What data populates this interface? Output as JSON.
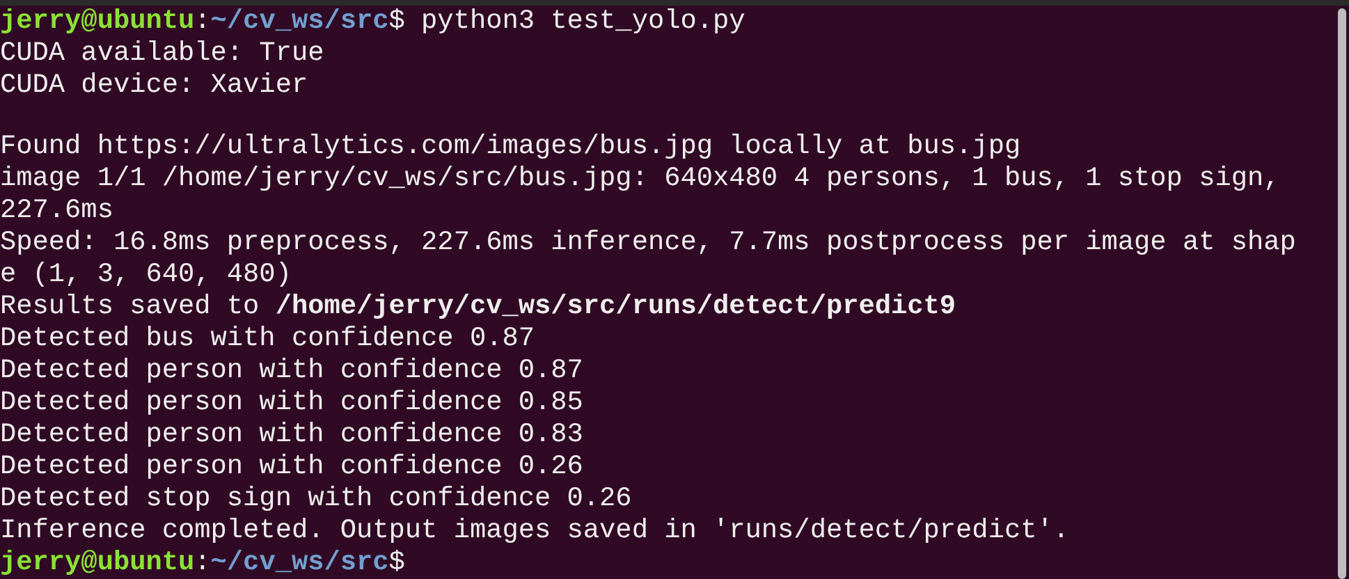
{
  "terminal": {
    "lines": [
      {
        "kind": "prompt",
        "user": "jerry@ubuntu",
        "separator": ":",
        "path": "~/cv_ws/src",
        "symbol": "$",
        "command": "python3 test_yolo.py"
      },
      {
        "kind": "output",
        "text": "CUDA available: True"
      },
      {
        "kind": "output",
        "text": "CUDA device: Xavier"
      },
      {
        "kind": "blank"
      },
      {
        "kind": "output",
        "text": "Found https://ultralytics.com/images/bus.jpg locally at bus.jpg"
      },
      {
        "kind": "output",
        "text": "image 1/1 /home/jerry/cv_ws/src/bus.jpg: 640x480 4 persons, 1 bus, 1 stop sign,"
      },
      {
        "kind": "output",
        "text": "227.6ms"
      },
      {
        "kind": "output",
        "text": "Speed: 16.8ms preprocess, 227.6ms inference, 7.7ms postprocess per image at shap"
      },
      {
        "kind": "output",
        "text": "e (1, 3, 640, 480)"
      },
      {
        "kind": "output",
        "text": "Results saved to **/home/jerry/cv_ws/src/runs/detect/predict9**"
      },
      {
        "kind": "output",
        "text": "Detected bus with confidence 0.87"
      },
      {
        "kind": "output",
        "text": "Detected person with confidence 0.87"
      },
      {
        "kind": "output",
        "text": "Detected person with confidence 0.85"
      },
      {
        "kind": "output",
        "text": "Detected person with confidence 0.83"
      },
      {
        "kind": "output",
        "text": "Detected person with confidence 0.26"
      },
      {
        "kind": "output",
        "text": "Detected stop sign with confidence 0.26"
      },
      {
        "kind": "output",
        "text": "Inference completed. Output images saved in 'runs/detect/predict'."
      },
      {
        "kind": "prompt",
        "user": "jerry@ubuntu",
        "separator": ":",
        "path": "~/cv_ws/src",
        "symbol": "$"
      }
    ]
  }
}
